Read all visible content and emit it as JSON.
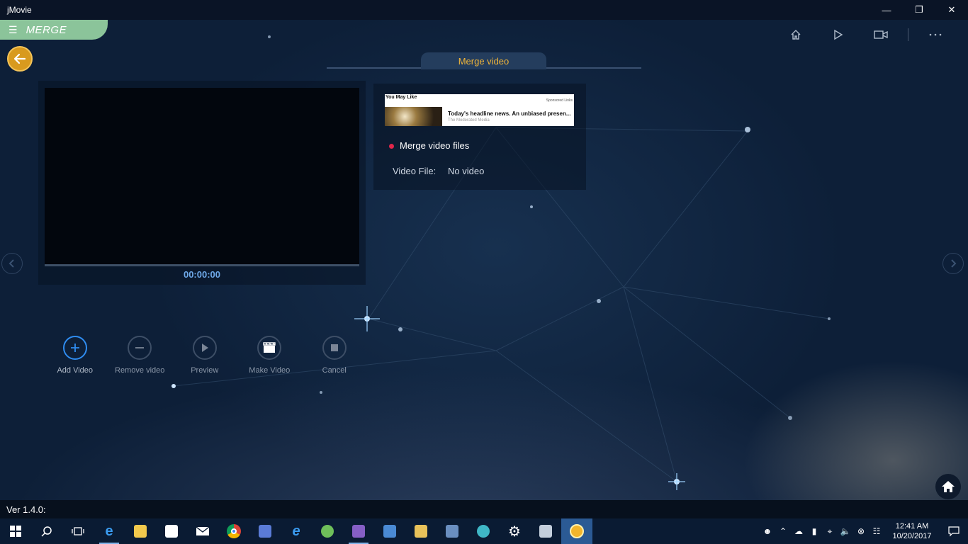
{
  "window": {
    "title": "jMovie"
  },
  "appbar": {
    "section_label": "MERGE",
    "icons": [
      "home-icon",
      "play-icon",
      "video-camera-icon",
      "more-icon"
    ]
  },
  "header": {
    "tab_label": "Merge video"
  },
  "player": {
    "time": "00:00:00"
  },
  "info": {
    "ad": {
      "you_may_like": "You May Like",
      "sponsored": "Sponsored Links",
      "headline": "Today's headline news. An unbiased presen...",
      "source": "The Moderated Media"
    },
    "status_label": "Merge video files",
    "video_file_label": "Video File:",
    "video_file_value": "No video"
  },
  "toolbar": {
    "add": "Add Video",
    "remove": "Remove video",
    "preview": "Preview",
    "make": "Make Video",
    "cancel": "Cancel"
  },
  "version": "Ver 1.4.0:",
  "taskbar": {
    "time": "12:41 AM",
    "date": "10/20/2017",
    "accent": "#2b5a94"
  },
  "colors": {
    "accent_green": "#8bc49a",
    "accent_orange": "#f0b53a",
    "accent_blue": "#2f8cf0",
    "status_red": "#e0264a"
  }
}
